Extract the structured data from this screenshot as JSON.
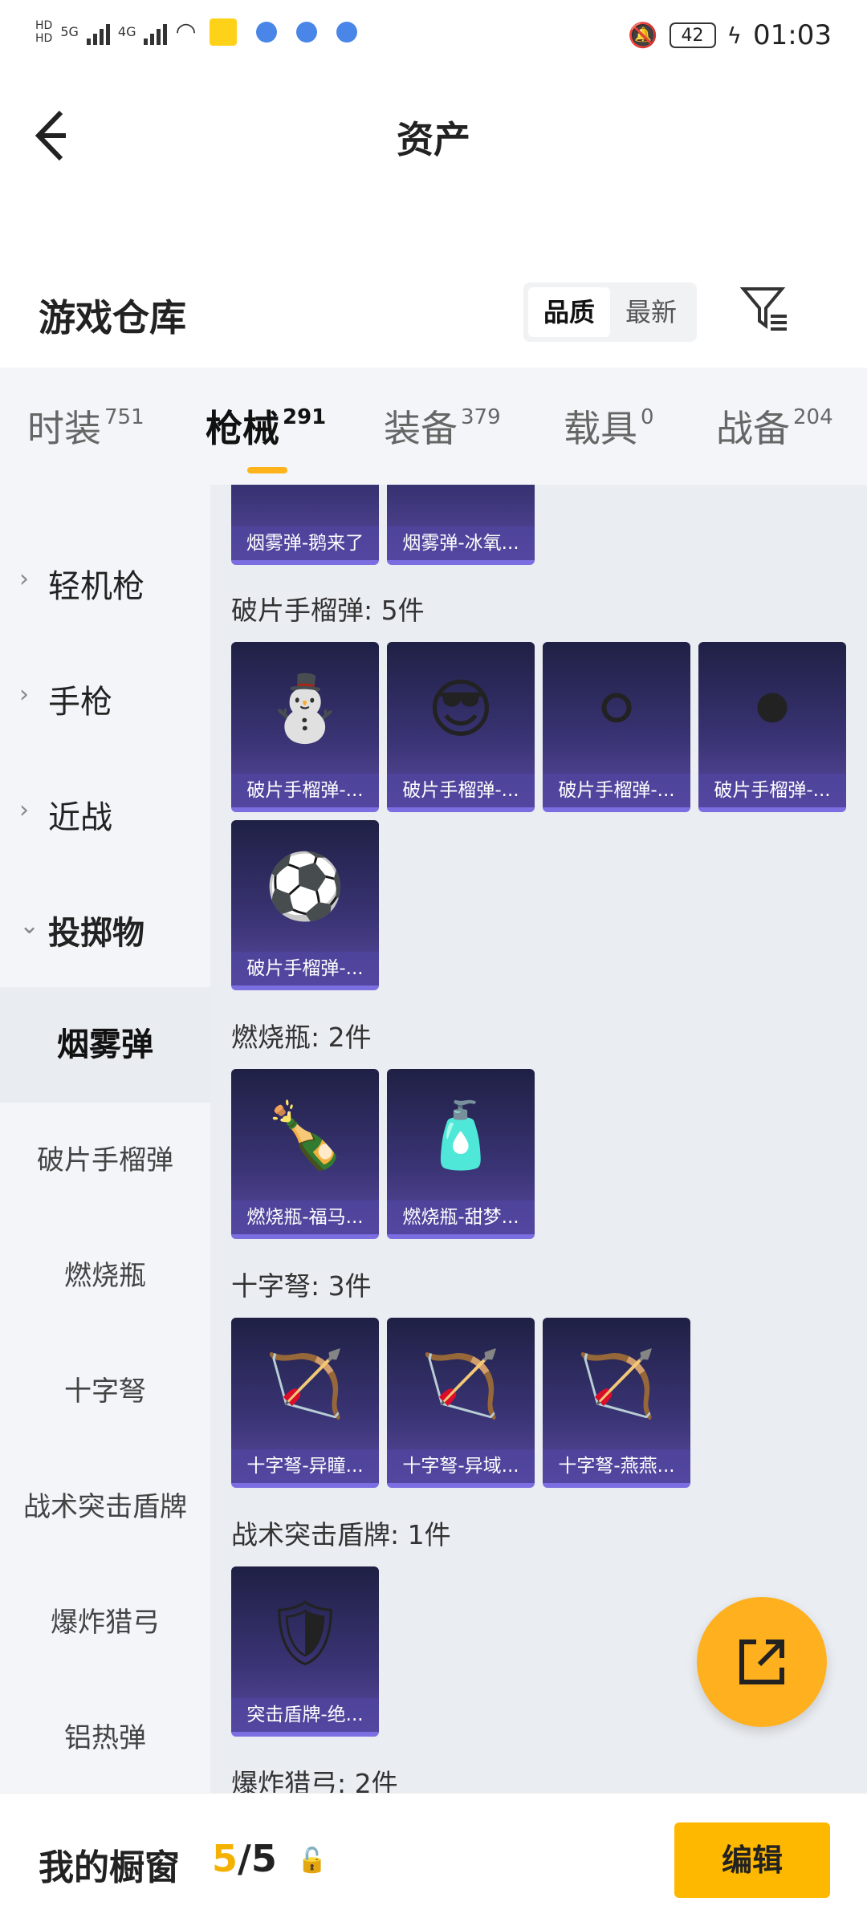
{
  "status": {
    "hd1": "HD",
    "hd2": "HD",
    "net1": "5G",
    "net2": "4G",
    "battery": "42",
    "time": "01:03"
  },
  "header": {
    "title": "资产",
    "back_icon": "chevron-left-icon"
  },
  "repo": {
    "title": "游戏仓库",
    "sort_options": [
      "品质",
      "最新"
    ],
    "active_sort": "品质"
  },
  "tabs": [
    {
      "label": "时装",
      "count": "751"
    },
    {
      "label": "枪械",
      "count": "291"
    },
    {
      "label": "装备",
      "count": "379"
    },
    {
      "label": "载具",
      "count": "0"
    },
    {
      "label": "战备",
      "count": "204"
    }
  ],
  "active_tab": "枪械",
  "sidebar": {
    "categories": [
      {
        "label": "轻机枪"
      },
      {
        "label": "手枪"
      },
      {
        "label": "近战"
      },
      {
        "label": "投掷物"
      }
    ],
    "subitems": [
      {
        "label": "烟雾弹"
      },
      {
        "label": "破片手榴弹"
      },
      {
        "label": "燃烧瓶"
      },
      {
        "label": "十字弩"
      },
      {
        "label": "战术突击盾牌"
      },
      {
        "label": "爆炸猎弓"
      },
      {
        "label": "铝热弹"
      }
    ]
  },
  "sections": [
    {
      "title": "",
      "items": [
        "烟雾弹-鹅来了",
        "烟雾弹-冰氧..."
      ]
    },
    {
      "title": "破片手榴弹: 5件",
      "items": [
        "破片手榴弹-...",
        "破片手榴弹-...",
        "破片手榴弹-...",
        "破片手榴弹-...",
        "破片手榴弹-..."
      ]
    },
    {
      "title": "燃烧瓶: 2件",
      "items": [
        "燃烧瓶-福马...",
        "燃烧瓶-甜梦..."
      ]
    },
    {
      "title": "十字弩: 3件",
      "items": [
        "十字弩-异瞳...",
        "十字弩-异域...",
        "十字弩-燕燕..."
      ]
    },
    {
      "title": "战术突击盾牌: 1件",
      "items": [
        "突击盾牌-绝..."
      ]
    },
    {
      "title": "爆炸猎弓: 2件",
      "items": []
    }
  ],
  "bottom": {
    "title": "我的橱窗",
    "count_current": "5",
    "count_sep": "/",
    "count_total": "5",
    "edit_label": "编辑"
  },
  "colors": {
    "accent": "#ffb800",
    "card": "#3a3475"
  }
}
